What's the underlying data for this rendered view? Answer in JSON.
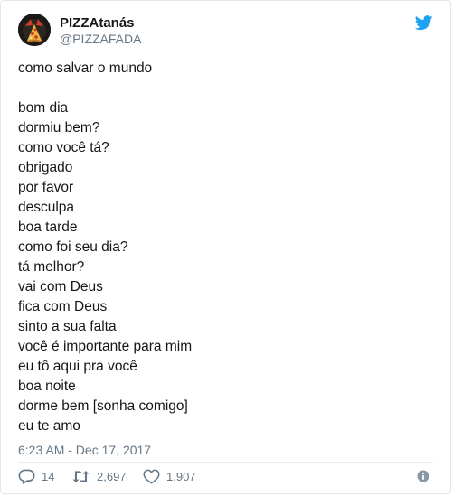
{
  "colors": {
    "text": "#14171a",
    "secondary": "#657786",
    "border": "#e1e8ed",
    "twitter_blue": "#1da1f2"
  },
  "user": {
    "display_name": "PIZZAtanás",
    "handle": "@PIZZAFADA",
    "avatar_icon": "pizza-demon-avatar"
  },
  "header": {
    "brand_icon": "twitter-bird-icon"
  },
  "tweet": {
    "text": "como salvar o mundo\n\nbom dia\ndormiu bem?\ncomo você tá?\nobrigado\npor favor\ndesculpa\nboa tarde\ncomo foi seu dia?\ntá melhor?\nvai com Deus\nfica com Deus\nsinto a sua falta\nvocê é importante para mim\neu tô aqui pra você\nboa noite\ndorme bem [sonha comigo]\neu te amo",
    "timestamp": "6:23 AM - Dec 17, 2017"
  },
  "actions": {
    "replies": "14",
    "retweets": "2,697",
    "likes": "1,907",
    "reply_icon": "reply-icon",
    "retweet_icon": "retweet-icon",
    "like_icon": "heart-icon",
    "info_icon": "info-icon"
  }
}
